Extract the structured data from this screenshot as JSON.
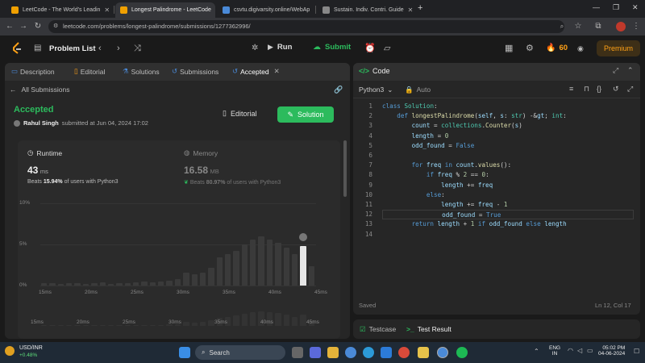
{
  "browser": {
    "tabs": [
      {
        "title": "LeetCode - The World's Leadin",
        "active": false,
        "color": "#f0a000"
      },
      {
        "title": "Longest Palindrome - LeetCode",
        "active": true,
        "color": "#f0a000"
      },
      {
        "title": "csvtu.digivarsity.online/WebAp",
        "active": false,
        "color": "#4a8ad8"
      },
      {
        "title": "Sustain. Indiv. Contri. Guide",
        "active": false,
        "color": "#888888"
      }
    ],
    "new_tab": "+",
    "url": "leetcode.com/problems/longest-palindrome/submissions/1277362996/"
  },
  "header": {
    "problem_list": "Problem List",
    "run": "Run",
    "submit": "Submit",
    "streak": "60",
    "premium": "Premium"
  },
  "left_tabs": [
    {
      "label": "Description"
    },
    {
      "label": "Editorial"
    },
    {
      "label": "Solutions"
    },
    {
      "label": "Submissions"
    },
    {
      "label": "Accepted"
    }
  ],
  "submission": {
    "back_label": "All Submissions",
    "status": "Accepted",
    "user": "Rahul Singh",
    "submitted_text": "submitted at Jun 04, 2024 17:02",
    "editorial_btn": "Editorial",
    "solution_btn": "Solution"
  },
  "runtime": {
    "label": "Runtime",
    "value": "43",
    "unit": "ms",
    "beats_prefix": "Beats",
    "beats_value": "15.94%",
    "beats_suffix": "of users with Python3"
  },
  "memory": {
    "label": "Memory",
    "value": "16.58",
    "unit": "MB",
    "beats_prefix": "Beats",
    "beats_value": "80.97%",
    "beats_suffix": "of users with Python3"
  },
  "chart_data": {
    "type": "bar",
    "ylabel_ticks": [
      "10%",
      "5%",
      "0%"
    ],
    "ylim": [
      0,
      10
    ],
    "x_ticks": [
      "15ms",
      "20ms",
      "25ms",
      "30ms",
      "35ms",
      "40ms",
      "45ms"
    ],
    "values": [
      0.3,
      0.3,
      0.2,
      0.3,
      0.3,
      0.2,
      0.3,
      0.4,
      0.2,
      0.3,
      0.3,
      0.4,
      0.5,
      0.4,
      0.5,
      0.6,
      0.8,
      1.6,
      1.4,
      1.6,
      2.2,
      3.4,
      3.8,
      4.2,
      5.0,
      5.6,
      6.0,
      5.6,
      5.2,
      4.6,
      3.8,
      4.8,
      2.4
    ],
    "highlight_index": 31,
    "highlight_value": 4.8
  },
  "code_panel": {
    "title": "Code",
    "language": "Python3",
    "auto": "Auto",
    "status": "Saved",
    "position": "Ln 12, Col 17",
    "lines": [
      "class Solution:",
      "    def longestPalindrome(self, s: str) -> int:",
      "        count = collections.Counter(s)",
      "        length = 0",
      "        odd_found = False",
      "",
      "        for freq in count.values():",
      "            if freq % 2 == 0:",
      "                length += freq",
      "            else:",
      "                length += freq - 1",
      "                odd_found = True",
      "        return length + 1 if odd_found else length",
      ""
    ]
  },
  "bottom_panel": {
    "testcase": "Testcase",
    "test_result": "Test Result"
  },
  "taskbar": {
    "ticker_name": "USD/INR",
    "ticker_change": "+0.48%",
    "search": "Search",
    "lang_top": "ENG",
    "lang_bottom": "IN",
    "time": "05:02 PM",
    "date": "04-06-2024"
  }
}
